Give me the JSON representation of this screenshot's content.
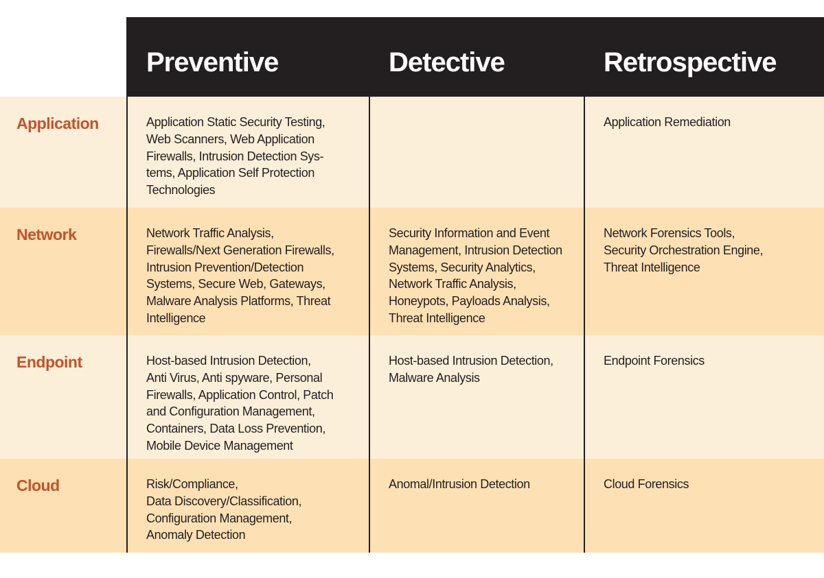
{
  "columns": [
    "Preventive",
    "Detective",
    "Retrospective"
  ],
  "rows": [
    {
      "label": "Application",
      "cells": [
        [
          "Application Static Security Testing,",
          "Web Scanners, Web Application",
          "Firewalls, Intrusion Detection Sys-",
          "tems, Application Self Protection",
          "Technologies"
        ],
        [],
        [
          "Application Remediation"
        ]
      ]
    },
    {
      "label": "Network",
      "cells": [
        [
          "Network Traffic Analysis,",
          "Firewalls/Next Generation Firewalls,",
          "Intrusion Prevention/Detection",
          "Systems, Secure Web, Gateways,",
          "Malware Analysis Platforms, Threat",
          "Intelligence"
        ],
        [
          "Security Information and Event",
          "Management, Intrusion Detection",
          "Systems, Security Analytics,",
          "Network Traffic Analysis,",
          "Honeypots, Payloads Analysis,",
          "Threat Intelligence"
        ],
        [
          "Network Forensics Tools,",
          "Security Orchestration Engine,",
          "Threat Intelligence"
        ]
      ]
    },
    {
      "label": "Endpoint",
      "cells": [
        [
          "Host-based Intrusion Detection,",
          "Anti Virus, Anti spyware, Personal",
          "Firewalls, Application Control, Patch",
          "and Configuration Management,",
          "Containers, Data Loss Prevention,",
          "Mobile Device Management"
        ],
        [
          "Host-based Intrusion Detection,",
          "Malware Analysis"
        ],
        [
          "Endpoint Forensics"
        ]
      ]
    },
    {
      "label": "Cloud",
      "cells": [
        [
          "Risk/Compliance,",
          "Data Discovery/Classification,",
          "Configuration Management,",
          "Anomaly Detection"
        ],
        [
          "Anomal/Intrusion Detection"
        ],
        [
          "Cloud Forensics"
        ]
      ]
    }
  ],
  "colors": {
    "header": "#231f20",
    "label": "#c4522a",
    "row_light": "#fcefd9",
    "row_dark": "#fde0b4"
  }
}
